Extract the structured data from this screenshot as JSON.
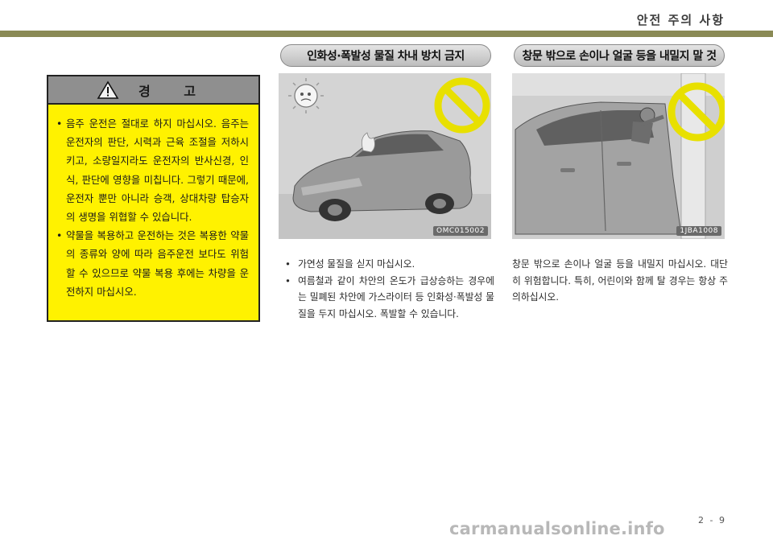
{
  "header": {
    "section_title": "안전 주의 사항"
  },
  "warning": {
    "title": "경 고",
    "items": [
      "음주 운전은 절대로 하지 마십시오. 음주는 운전자의 판단, 시력과 근육 조절을 저하시키고, 소량일지라도 운전자의 반사신경, 인식, 판단에 영향을 미칩니다. 그렇기 때문에, 운전자 뿐만 아니라 승객, 상대차량 탑승자의 생명을 위협할 수 있습니다.",
      "약물을 복용하고 운전하는 것은 복용한 약물의 종류와 양에 따라 음주운전 보다도 위험할 수 있으므로 약물 복용 후에는 차량을 운전하지 마십시오."
    ]
  },
  "section_a": {
    "heading": "인화성·폭발성 물질 차내 방치 금지",
    "image_code": "OMC015002",
    "items": [
      "가연성 물질을 싣지 마십시오.",
      "여름철과 같이 차안의 온도가 급상승하는 경우에는 밀폐된 차안에 가스라이터 등 인화성·폭발성 물질을 두지 마십시오. 폭발할 수 있습니다."
    ]
  },
  "section_b": {
    "heading": "창문 밖으로 손이나 얼굴 등을 내밀지 말 것",
    "image_code": "1JBA1008",
    "text": "창문 밖으로 손이나 얼굴 등을 내밀지 마십시오. 대단히 위험합니다. 특히, 어린이와 함께 탈 경우는 항상 주의하십시오."
  },
  "footer": {
    "page_number": "2 - 9",
    "watermark": "carmanualsonline.info"
  }
}
